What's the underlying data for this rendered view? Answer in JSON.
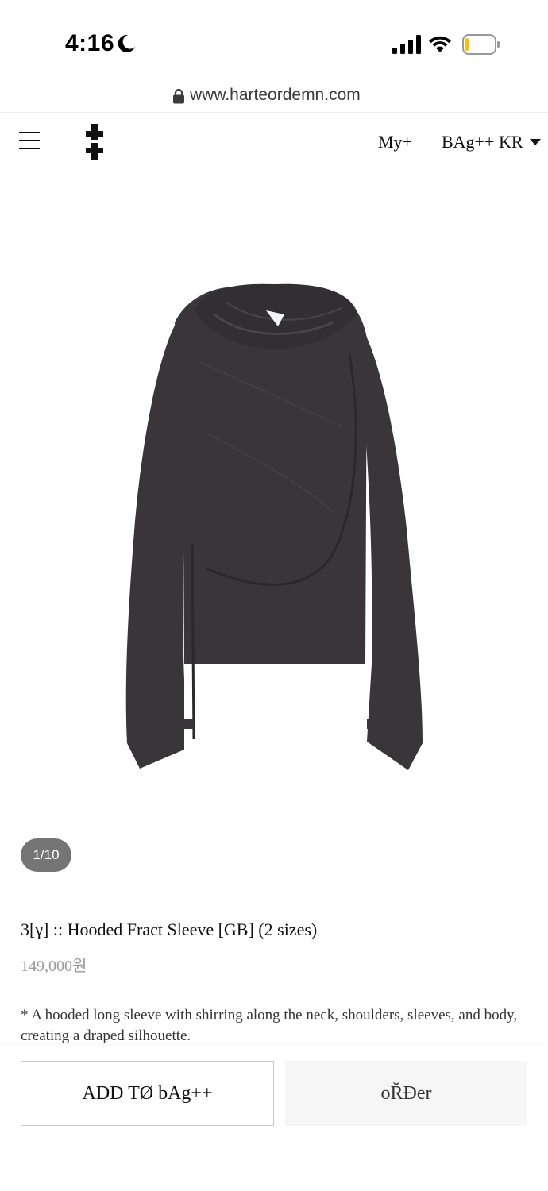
{
  "status_bar": {
    "time": "4:16",
    "icons": [
      "moon-icon",
      "signal-icon",
      "wifi-icon",
      "battery-icon"
    ]
  },
  "browser": {
    "url": "www.harteordemn.com",
    "icon": "lock-icon"
  },
  "header": {
    "menu_icon": "menu-icon",
    "logo": "double-cross-logo",
    "my_label": "My+",
    "bag_label": "BAg++",
    "language": "KR"
  },
  "gallery": {
    "counter": "1/10",
    "image_subject": "dark charcoal hooded long sleeve"
  },
  "product": {
    "title": "3[γ] :: Hooded Fract Sleeve [GB] (2 sizes)",
    "price": "149,000원",
    "description": "* A hooded long sleeve with shirring along the neck, shoulders, sleeves, and body, creating a draped silhouette."
  },
  "actions": {
    "add_to_bag": "ADD TØ bAg++",
    "order": "oŘĐer"
  },
  "colors": {
    "garment": "#3a3538",
    "badge": "#757575",
    "price": "#9a9a9a",
    "order_bg": "#f6f6f6"
  }
}
